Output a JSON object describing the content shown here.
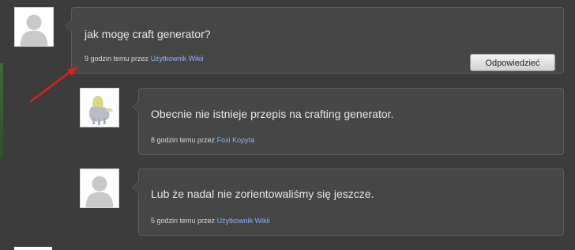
{
  "thread": {
    "comments": [
      {
        "message": "jak mogę craft generator?",
        "time_prefix": "9 godzin temu przez",
        "author": "Użytkownik Wikii",
        "reply_label": "Odpowiedzieć",
        "avatar": "default-user-icon"
      }
    ],
    "replies": [
      {
        "message": "Obecnie nie istnieje przepis na crafting generator.",
        "time_prefix": "8 godzin temu przez",
        "author": "Foxi Kopyta",
        "avatar": "pony-avatar"
      },
      {
        "message": "Lub że nadal nie zorientowaliśmy się jeszcze.",
        "time_prefix": "5 godzin temu przez",
        "author": "Użytkownik Wikii",
        "avatar": "default-user-icon"
      }
    ]
  },
  "colors": {
    "background": "#3c3c3c",
    "bubble": "#464646",
    "link": "#8db0ff",
    "annotation_arrow": "#e0201f"
  }
}
